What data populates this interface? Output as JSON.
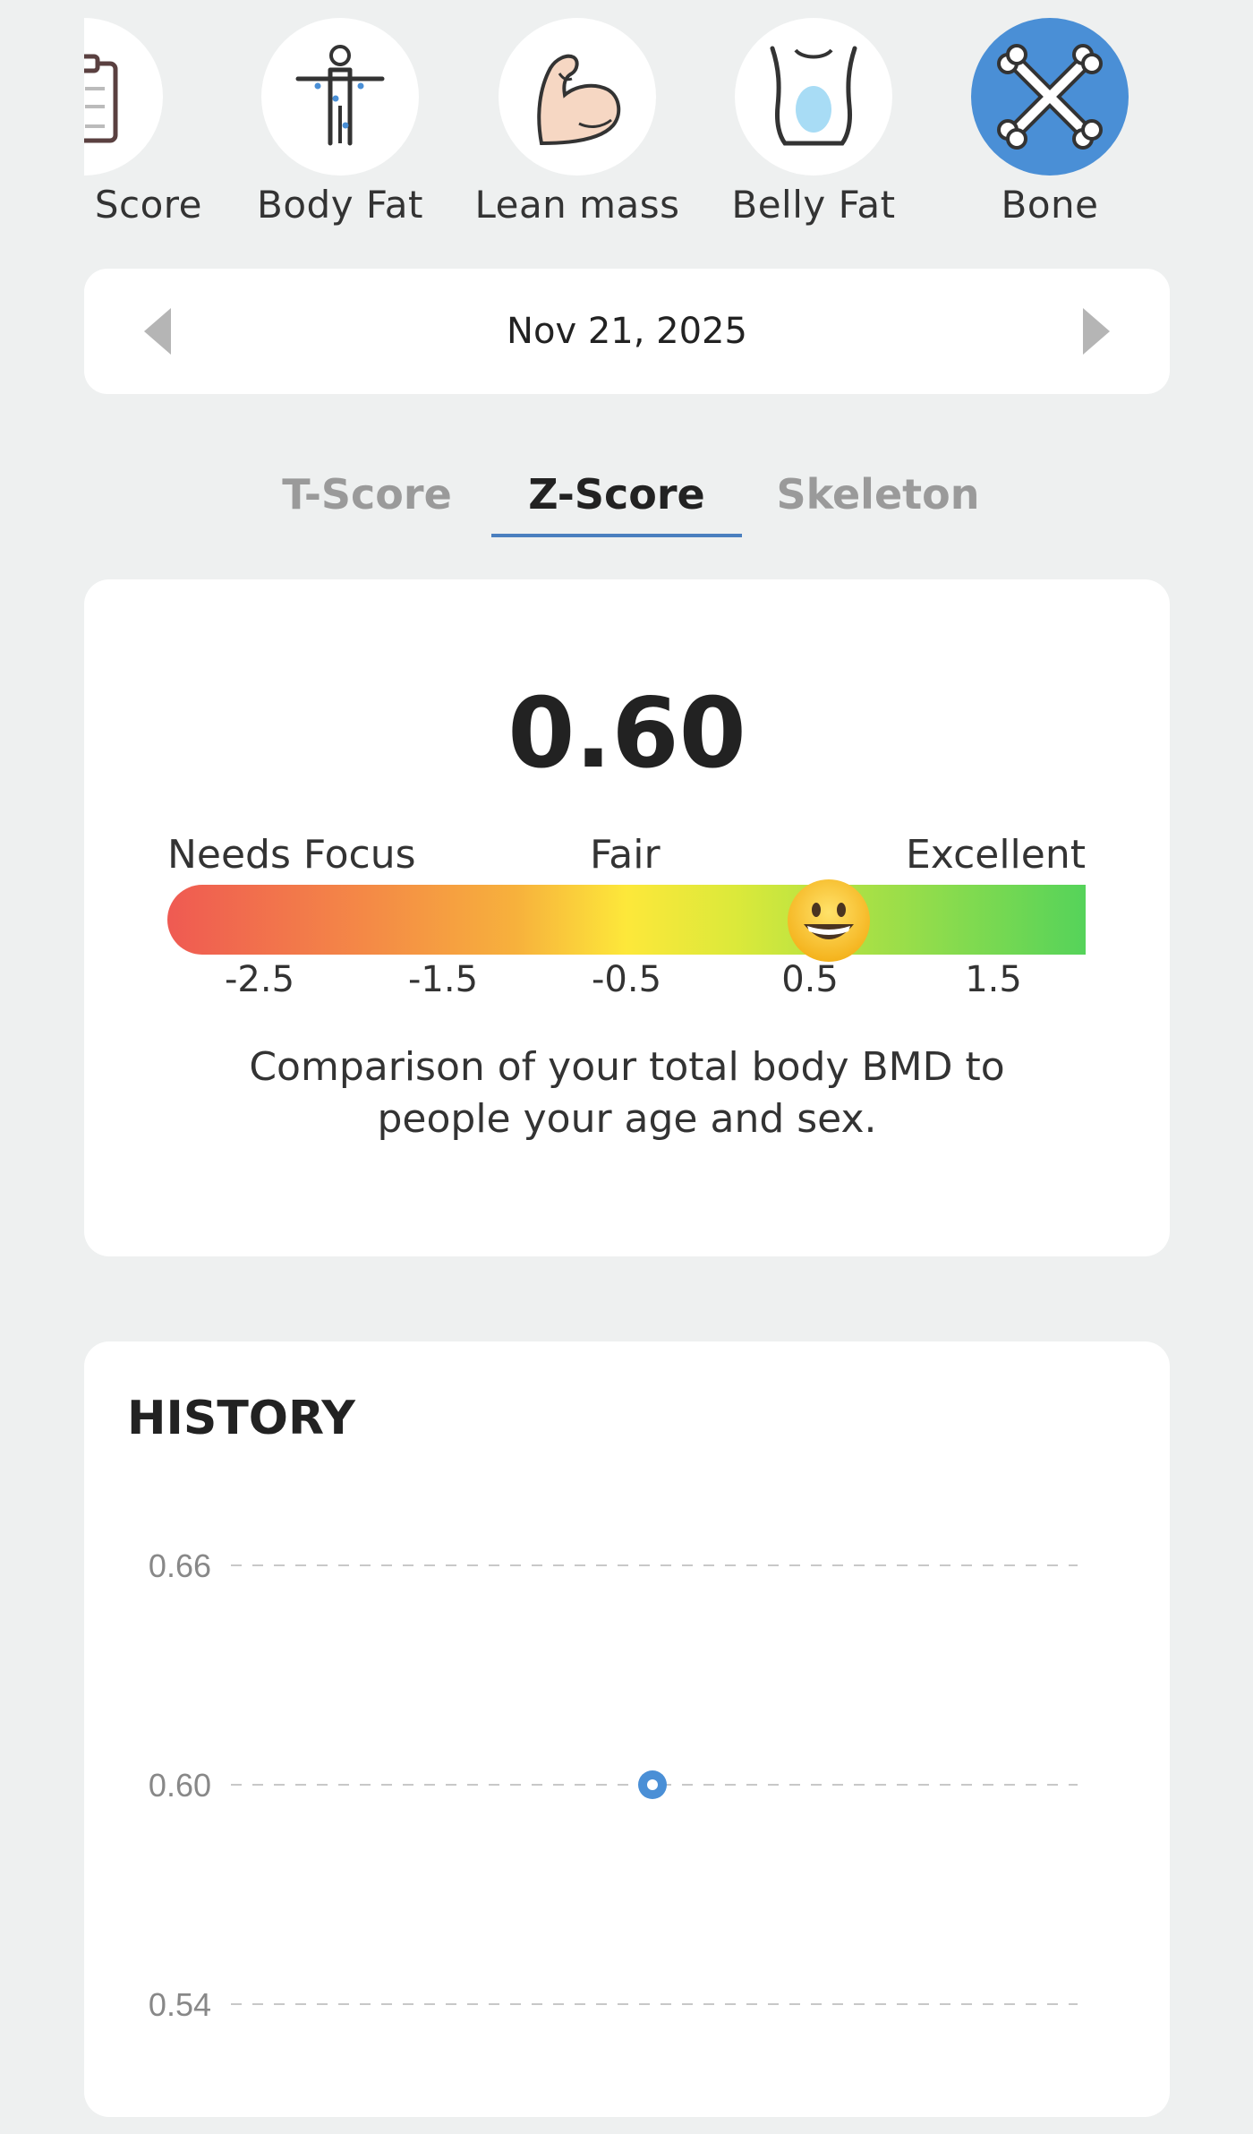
{
  "categories": [
    {
      "label": "y Score",
      "icon": "clipboard-checklist-icon",
      "active": false
    },
    {
      "label": "Body Fat",
      "icon": "body-figure-icon",
      "active": false
    },
    {
      "label": "Lean mass",
      "icon": "flexed-arm-icon",
      "active": false
    },
    {
      "label": "Belly Fat",
      "icon": "torso-icon",
      "active": false
    },
    {
      "label": "Bone",
      "icon": "crossed-bones-icon",
      "active": true
    }
  ],
  "date_nav": {
    "date": "Nov 21, 2025",
    "prev_icon": "chevron-left-icon",
    "next_icon": "chevron-right-icon"
  },
  "tabs": [
    {
      "label": "T-Score",
      "active": false
    },
    {
      "label": "Z-Score",
      "active": true
    },
    {
      "label": "Skeleton",
      "active": false
    }
  ],
  "score": {
    "value": "0.60",
    "range_labels": {
      "low": "Needs Focus",
      "mid": "Fair",
      "high": "Excellent"
    },
    "ticks": [
      "-2.5",
      "-1.5",
      "-0.5",
      "0.5",
      "1.5"
    ],
    "marker_value": 0.6,
    "marker_icon": "smiley-face-icon",
    "description": "Comparison of your total body BMD to people your age and sex."
  },
  "history": {
    "title": "HISTORY",
    "chart_data": {
      "type": "scatter",
      "y_ticks": [
        "0.66",
        "0.60",
        "0.54"
      ],
      "ylim": [
        0.54,
        0.66
      ],
      "points": [
        {
          "y": 0.6
        }
      ],
      "color": "#4a8fd6",
      "grid": true
    }
  },
  "colors": {
    "accent": "#4a8fd6",
    "background": "#eef0f0",
    "card": "#ffffff"
  }
}
